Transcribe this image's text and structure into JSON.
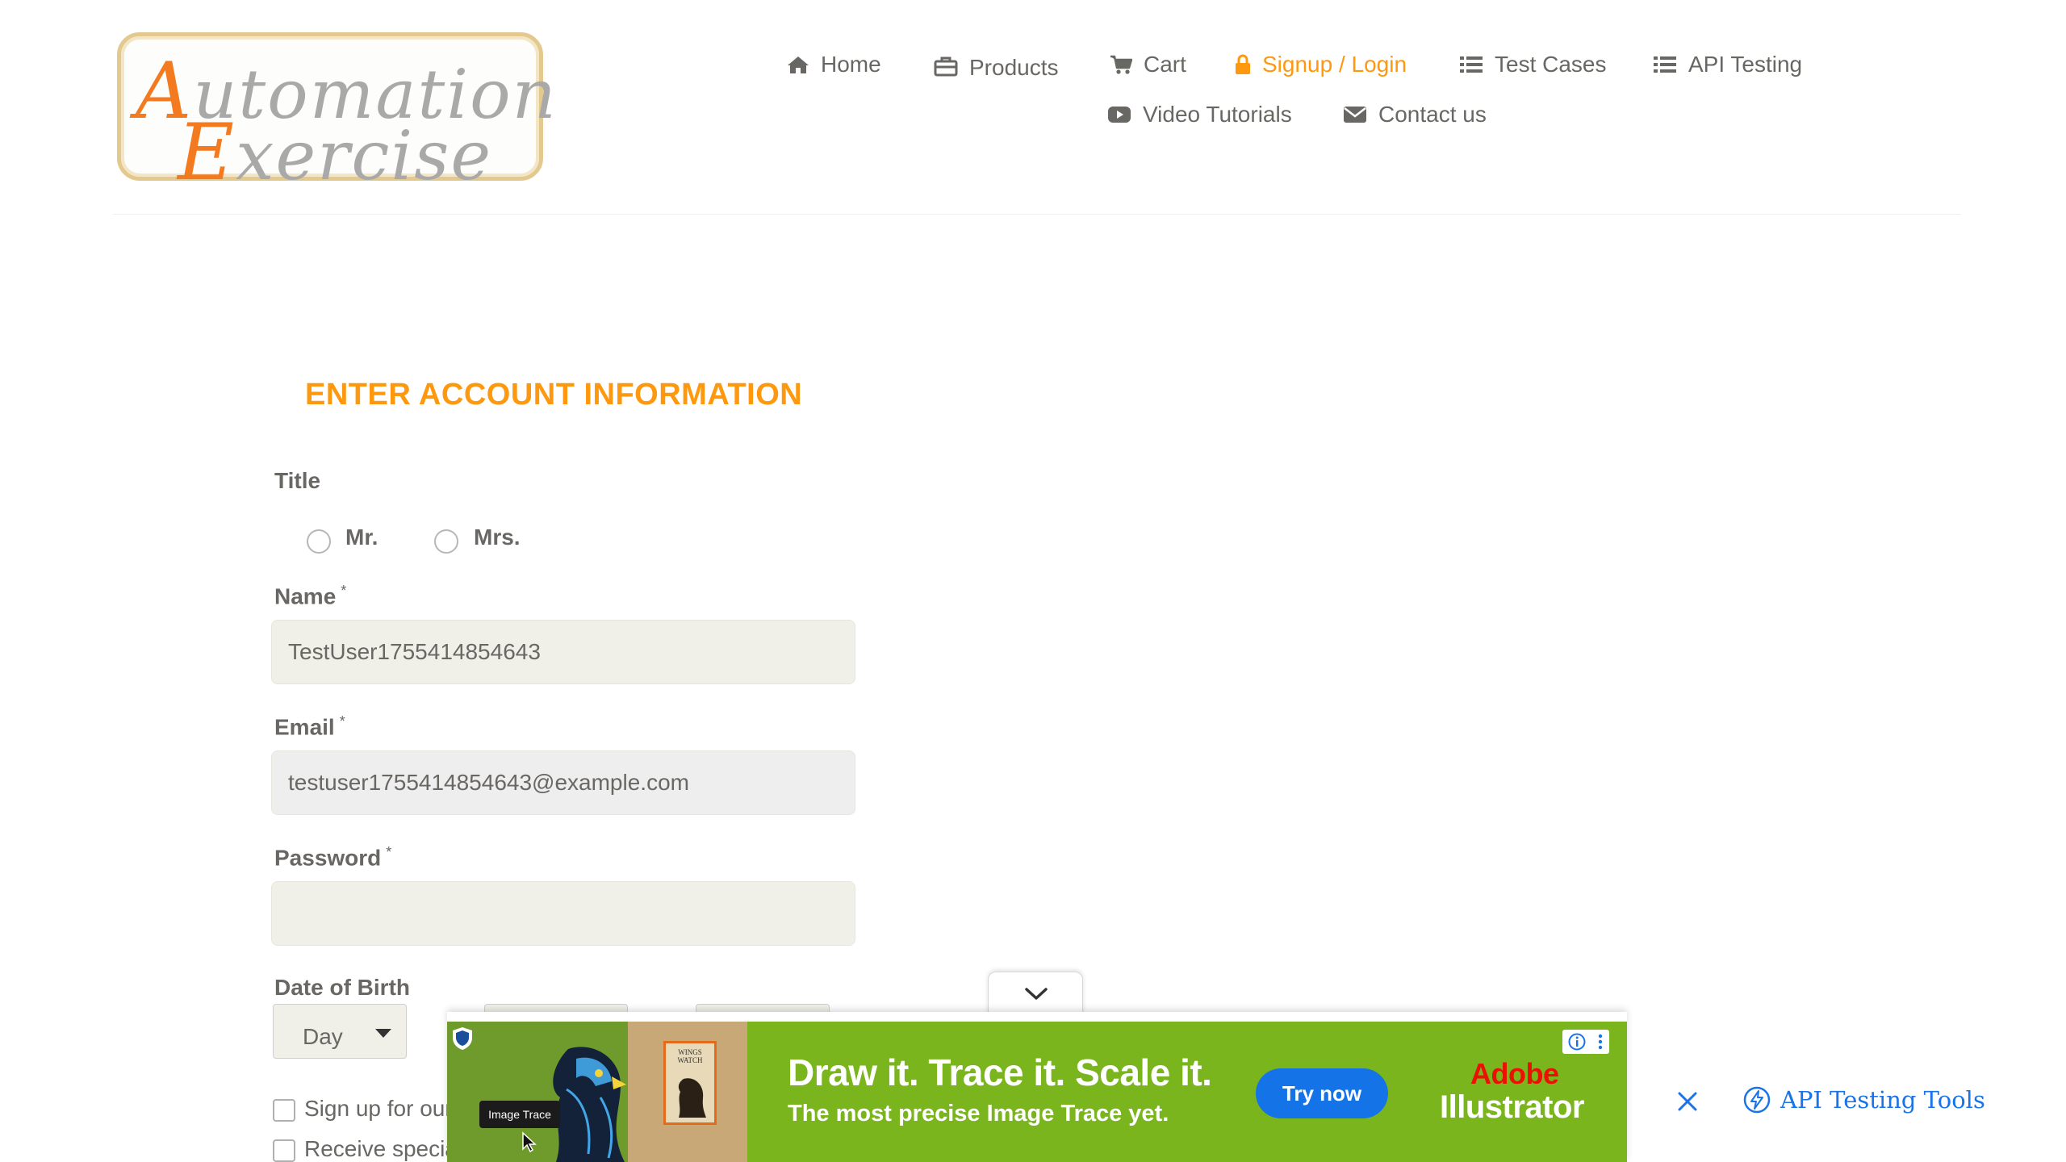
{
  "logo": {
    "line1_cap": "A",
    "line1_rest": "utomation",
    "line2_cap": "E",
    "line2_rest": "xercise"
  },
  "nav": {
    "home": "Home",
    "products": "Products",
    "cart": "Cart",
    "signup_login": "Signup / Login",
    "test_cases": "Test Cases",
    "api_testing": "API Testing",
    "video_tutorials": "Video Tutorials",
    "contact_us": "Contact us",
    "active": "signup_login"
  },
  "form": {
    "title": "ENTER ACCOUNT INFORMATION",
    "title_label": "Title",
    "title_options": [
      "Mr.",
      "Mrs."
    ],
    "name_label": "Name",
    "name_value": "TestUser1755414854643",
    "email_label": "Email",
    "email_value": "testuser1755414854643@example.com",
    "password_label": "Password",
    "password_value": "",
    "required_mark": "*",
    "dob_label": "Date of Birth",
    "dob_day": "Day",
    "newsletter_label": "Sign up for our",
    "offers_label": "Receive specia"
  },
  "ad": {
    "art_badge": "Image Trace",
    "art_book": "WINGS WATCH",
    "headline": "Draw it. Trace it. Scale it.",
    "subline": "The most precise Image Trace yet.",
    "cta": "Try now",
    "brand_line1": "Adobe",
    "brand_line2": "Illustrator"
  },
  "side_link": {
    "label": "API Testing Tools"
  },
  "colors": {
    "accent": "#FE980F",
    "text": "#696763",
    "ad_green": "#7AB51D",
    "ad_button": "#1473E6",
    "link_blue": "#1A73E8"
  },
  "icons": {
    "home": "home-icon",
    "products": "briefcase-icon",
    "cart": "cart-icon",
    "signup": "lock-icon",
    "test_cases": "list-icon",
    "api_testing": "list-icon",
    "video": "play-icon",
    "contact": "envelope-icon"
  }
}
